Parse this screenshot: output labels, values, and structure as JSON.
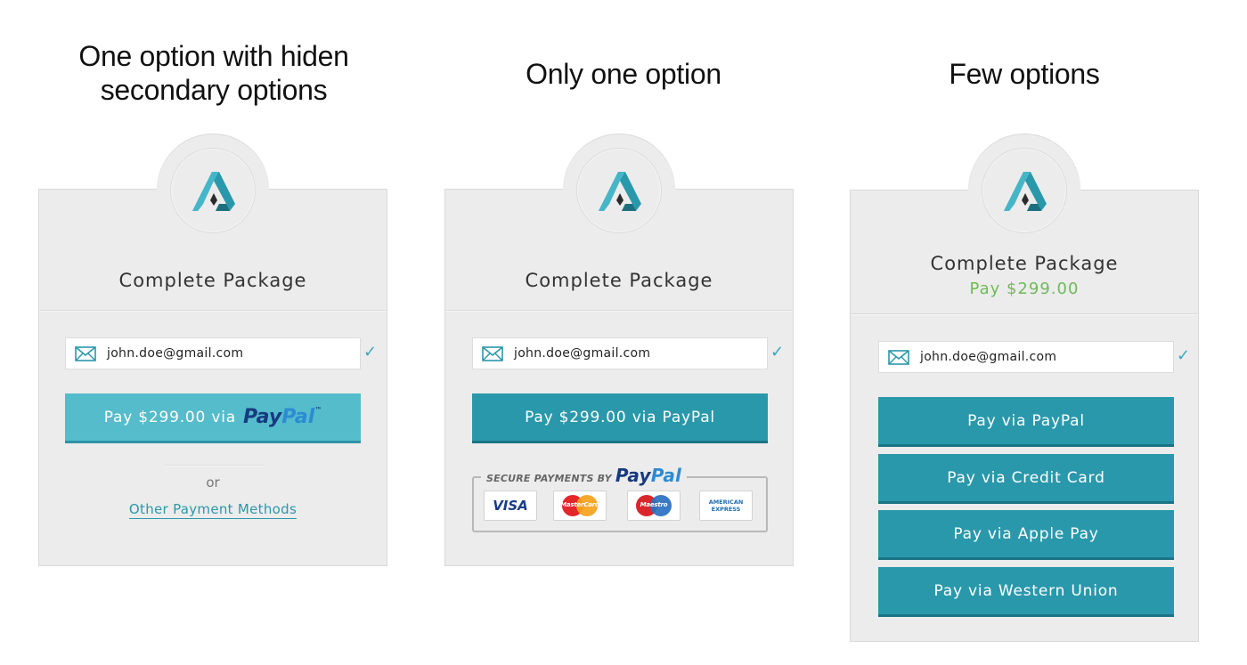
{
  "headings": {
    "left_line1": "One option with hiden",
    "left_line2": "secondary options",
    "middle": "Only one option",
    "right": "Few options"
  },
  "colors": {
    "accent": "#2a98ab",
    "accent_light": "#55bccb",
    "price_green": "#6fba5a",
    "paypal_dark": "#173a80",
    "paypal_light": "#2b8cd4",
    "card_bg": "#ececec"
  },
  "cards": [
    {
      "logo_icon": "triangle-logo-icon",
      "title": "Complete Package",
      "email": "john.doe@gmail.com",
      "email_icon": "envelope-icon",
      "check_icon": "✓",
      "button": {
        "label": "Pay $299.00 via",
        "paypal_pay": "Pay",
        "paypal_pal": "Pal",
        "tm": "™"
      },
      "or": "or",
      "link": "Other Payment Methods"
    },
    {
      "logo_icon": "triangle-logo-icon",
      "title": "Complete Package",
      "email": "john.doe@gmail.com",
      "email_icon": "envelope-icon",
      "check_icon": "✓",
      "button": {
        "label": "Pay $299.00 via PayPal"
      },
      "secure": {
        "prefix": "SECURE PAYMENTS BY",
        "paypal_pay": "Pay",
        "paypal_pal": "Pal"
      },
      "card_brands": {
        "visa": "VISA",
        "mastercard": "MasterCard",
        "maestro": "Maestro",
        "amex_line1": "AMERICAN",
        "amex_line2": "EXPRESS"
      }
    },
    {
      "logo_icon": "triangle-logo-icon",
      "title": "Complete Package",
      "price": "Pay $299.00",
      "email": "john.doe@gmail.com",
      "email_icon": "envelope-icon",
      "check_icon": "✓",
      "buttons": [
        "Pay via  PayPal",
        "Pay via Credit Card",
        "Pay via Apple Pay",
        "Pay via Western Union"
      ]
    }
  ]
}
